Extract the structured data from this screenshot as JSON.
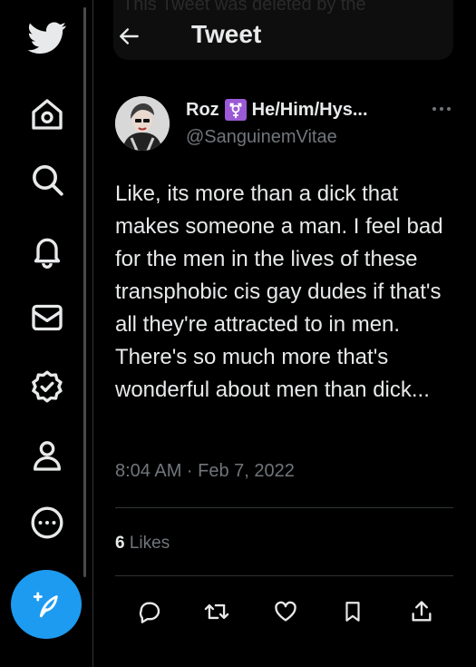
{
  "header": {
    "title": "Tweet",
    "overlay_text": "This Tweet was deleted by the"
  },
  "tweet": {
    "display_name": "Roz",
    "name_suffix": "He/Him/Hys...",
    "handle": "@SanguinemVitae",
    "text": "Like, its more than a dick that makes someone a man. I feel bad for the men in the lives of these transphobic cis gay dudes if that's all they're attracted to in men. There's so much more that's wonderful about men than dick...",
    "timestamp": "8:04 AM · Feb 7, 2022",
    "likes_count": "6",
    "likes_label": "Likes"
  },
  "icons": {
    "nav": [
      "twitter-logo-icon",
      "home-icon",
      "search-icon",
      "notifications-bell-icon",
      "messages-envelope-icon",
      "verified-badge-icon",
      "profile-icon",
      "more-circle-icon",
      "compose-tweet-icon"
    ],
    "actions": [
      "reply-icon",
      "retweet-icon",
      "like-icon",
      "bookmark-icon",
      "share-icon"
    ]
  },
  "colors": {
    "accent": "#1d9bf0",
    "background": "#000000",
    "text": "#e7e9ea",
    "muted": "#71767b",
    "divider": "#2f3336",
    "tag": "#9b59d6"
  }
}
